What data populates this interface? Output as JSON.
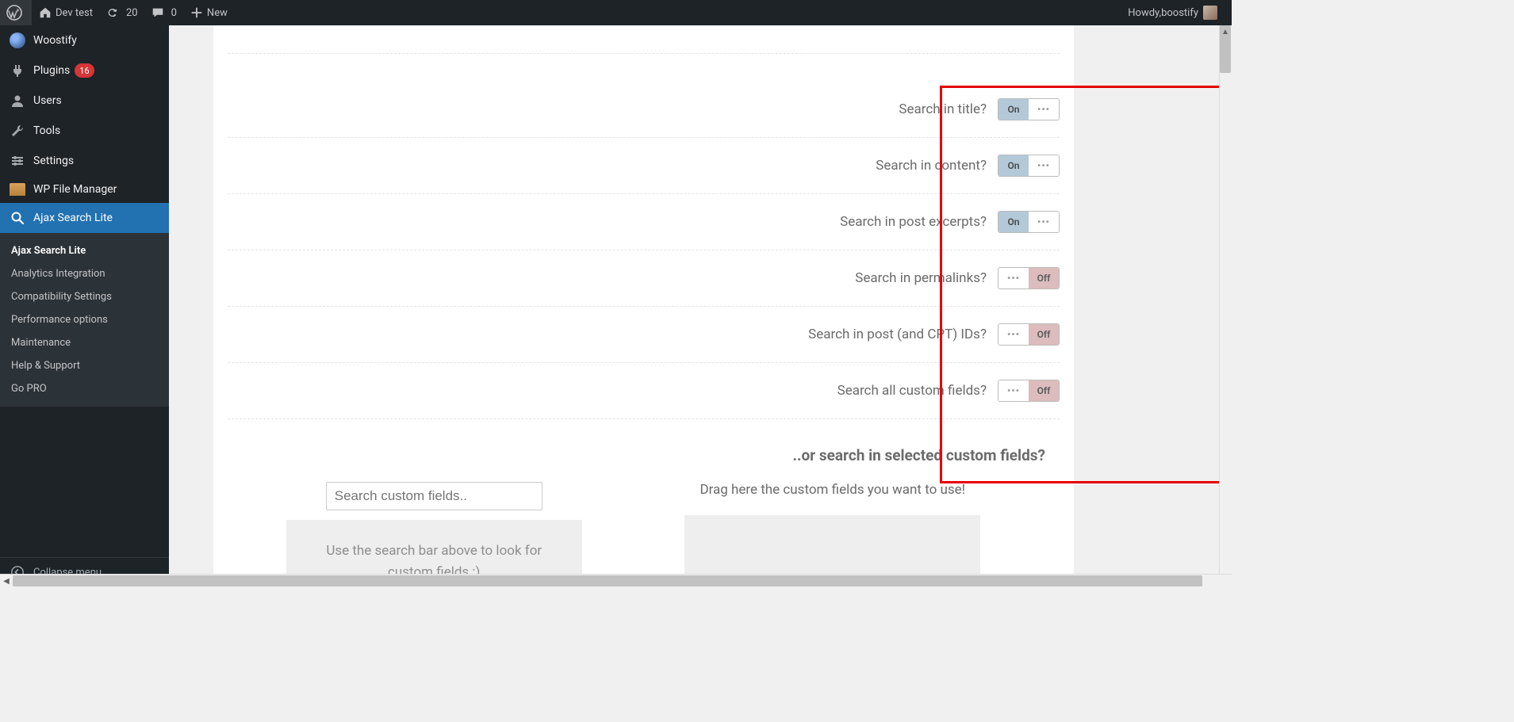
{
  "adminbar": {
    "site_name": "Dev test",
    "updates": "20",
    "comments": "0",
    "new": "New",
    "howdy_prefix": "Howdy, ",
    "user": "boostify"
  },
  "sidebar": {
    "items": [
      {
        "label": "Woostify"
      },
      {
        "label": "Plugins",
        "badge": "16"
      },
      {
        "label": "Users"
      },
      {
        "label": "Tools"
      },
      {
        "label": "Settings"
      },
      {
        "label": "WP File Manager"
      },
      {
        "label": "Ajax Search Lite"
      }
    ],
    "submenu": [
      {
        "label": "Ajax Search Lite"
      },
      {
        "label": "Analytics Integration"
      },
      {
        "label": "Compatibility Settings"
      },
      {
        "label": "Performance options"
      },
      {
        "label": "Maintenance"
      },
      {
        "label": "Help & Support"
      },
      {
        "label": "Go PRO"
      }
    ],
    "collapse": "Collapse menu"
  },
  "options": [
    {
      "label": "Search in title?",
      "state": "on"
    },
    {
      "label": "Search in content?",
      "state": "on"
    },
    {
      "label": "Search in post excerpts?",
      "state": "on"
    },
    {
      "label": "Search in permalinks?",
      "state": "off"
    },
    {
      "label": "Search in post (and CPT) IDs?",
      "state": "off"
    },
    {
      "label": "Search all custom fields?",
      "state": "off"
    }
  ],
  "toggle_labels": {
    "on": "On",
    "off": "Off"
  },
  "section_heading": "..or search in selected custom fields?",
  "cf": {
    "search_placeholder": "Search custom fields..",
    "search_help": "Use the search bar above to look for custom fields :)",
    "drag_label": "Drag here the custom fields you want to use!"
  }
}
